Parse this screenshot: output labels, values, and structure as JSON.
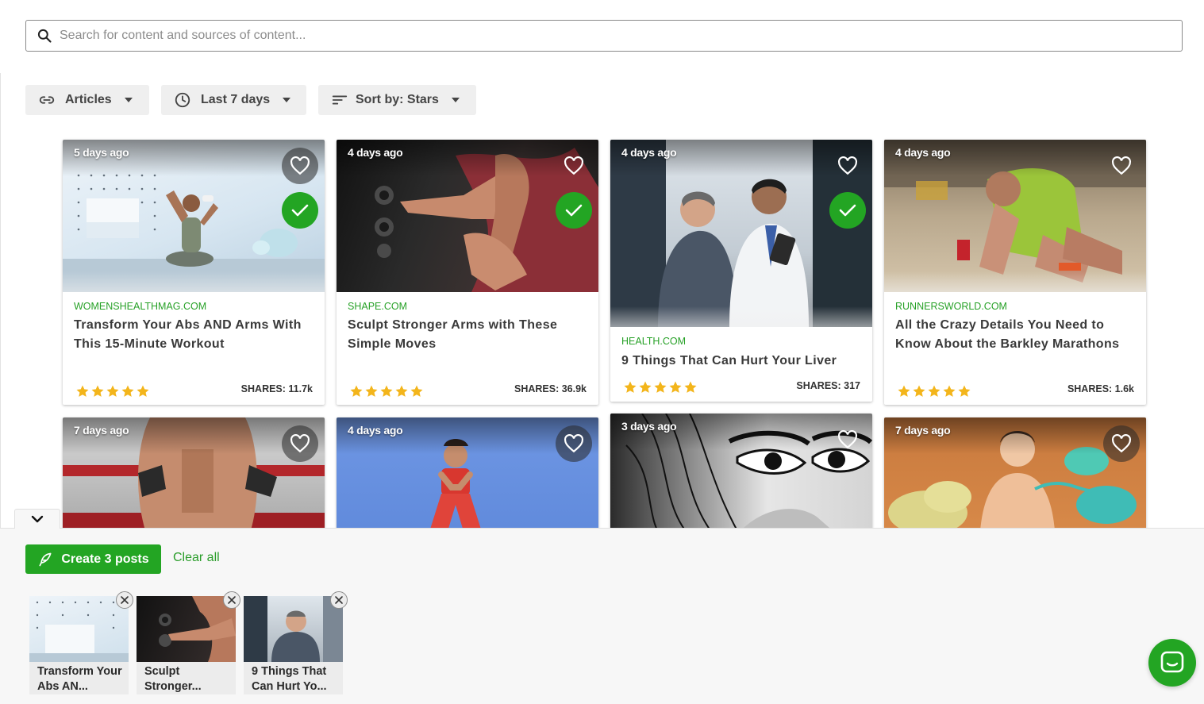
{
  "search": {
    "placeholder": "Search for content and sources of content..."
  },
  "filters": {
    "type": "Articles",
    "range": "Last 7 days",
    "sort": "Sort by: Stars"
  },
  "cards": [
    {
      "age": "5 days ago",
      "source": "WOMENSHEALTHMAG.COM",
      "title": "Transform Your Abs AND Arms With This 15-Minute Workout",
      "stars": 5,
      "shares": "SHARES: 11.7k",
      "selected": true
    },
    {
      "age": "4 days ago",
      "source": "SHAPE.COM",
      "title": "Sculpt Stronger Arms with These Simple Moves",
      "stars": 5,
      "shares": "SHARES: 36.9k",
      "selected": true
    },
    {
      "age": "4 days ago",
      "source": "HEALTH.COM",
      "title": "9 Things That Can Hurt Your Liver",
      "stars": 5,
      "shares": "SHARES: 317",
      "selected": true
    },
    {
      "age": "4 days ago",
      "source": "RUNNERSWORLD.COM",
      "title": "All the Crazy Details You Need to Know About the Barkley Marathons",
      "stars": 5,
      "shares": "SHARES: 1.6k",
      "selected": false
    },
    {
      "age": "7 days ago"
    },
    {
      "age": "4 days ago"
    },
    {
      "age": "3 days ago"
    },
    {
      "age": "7 days ago"
    }
  ],
  "bottom": {
    "create_label": "Create 3 posts",
    "clear_label": "Clear all",
    "selected": [
      {
        "label": "Transform Your Abs AN..."
      },
      {
        "label": "Sculpt Stronger..."
      },
      {
        "label": "9 Things That Can Hurt Yo..."
      }
    ]
  },
  "colors": {
    "accent": "#23a523",
    "source_text": "#27a127",
    "star": "#f3b51b"
  }
}
